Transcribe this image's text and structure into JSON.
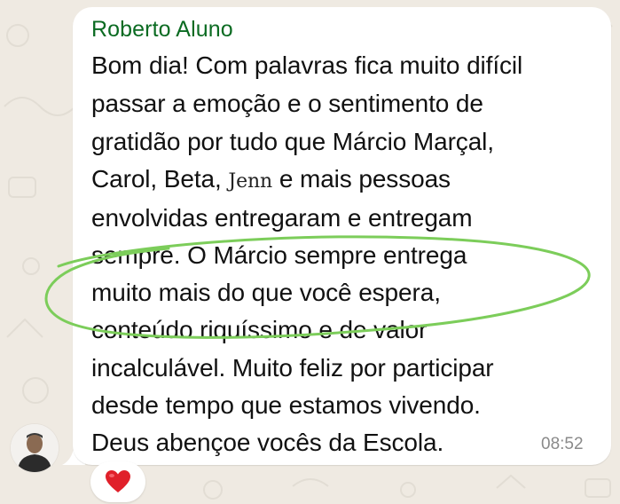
{
  "message": {
    "sender": "Roberto Aluno",
    "time": "08:52",
    "lines": {
      "l1": "Bom dia! Com palavras fica muito difícil",
      "l2": "passar a emoção e o sentimento de",
      "l3": "gratidão por tudo que Márcio Marçal,",
      "l4a": "Carol, Beta,",
      "l4handle": "Jenn",
      "l4b": "e mais pessoas",
      "l5": "envolvidas entregaram e entregam",
      "l6": "sempre. O Márcio sempre entrega",
      "l7": "muito mais do que você espera,",
      "l8": "conteúdo riquíssimo e de valor",
      "l9": "incalculável. Muito feliz por participar",
      "l10": "desde tempo que estamos vivendo.",
      "l11": "Deus abençoe vocês da Escola."
    }
  },
  "reaction": {
    "emoji_icon": "red-heart-icon",
    "color": "#e0202a"
  },
  "colors": {
    "chat_background": "#efeae2",
    "sender_name": "#0b6b22",
    "highlight_ellipse": "#7ccd5a"
  }
}
